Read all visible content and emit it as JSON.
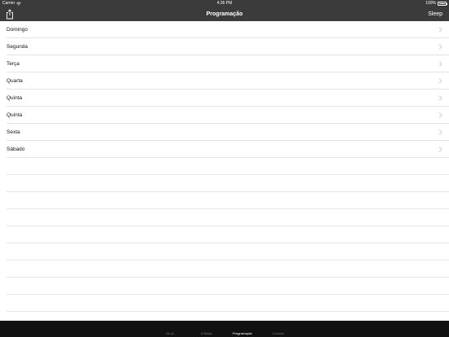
{
  "status_bar": {
    "carrier": "Carrier",
    "time": "4:36 PM",
    "battery": "100%",
    "battery_level": 1.0
  },
  "nav_bar": {
    "title": "Programação",
    "left_icon": "share-icon",
    "right_button": "Sleep"
  },
  "schedule": {
    "items": [
      {
        "label": "Domingo"
      },
      {
        "label": "Segunda"
      },
      {
        "label": "Terça"
      },
      {
        "label": "Quarta"
      },
      {
        "label": "Quinta"
      },
      {
        "label": "Quinta"
      },
      {
        "label": "Sexta"
      },
      {
        "label": "Sábado"
      }
    ]
  },
  "tab_bar": {
    "tabs": [
      {
        "label": "No Ar"
      },
      {
        "label": "A Rádio"
      },
      {
        "label": "Programação"
      },
      {
        "label": "Contato"
      }
    ],
    "active": "Programação"
  },
  "colors": {
    "bar_background": "#3b3b3b",
    "tab_background": "#111111",
    "separator": "#e3e3e3",
    "chevron": "#c7c7cc"
  }
}
